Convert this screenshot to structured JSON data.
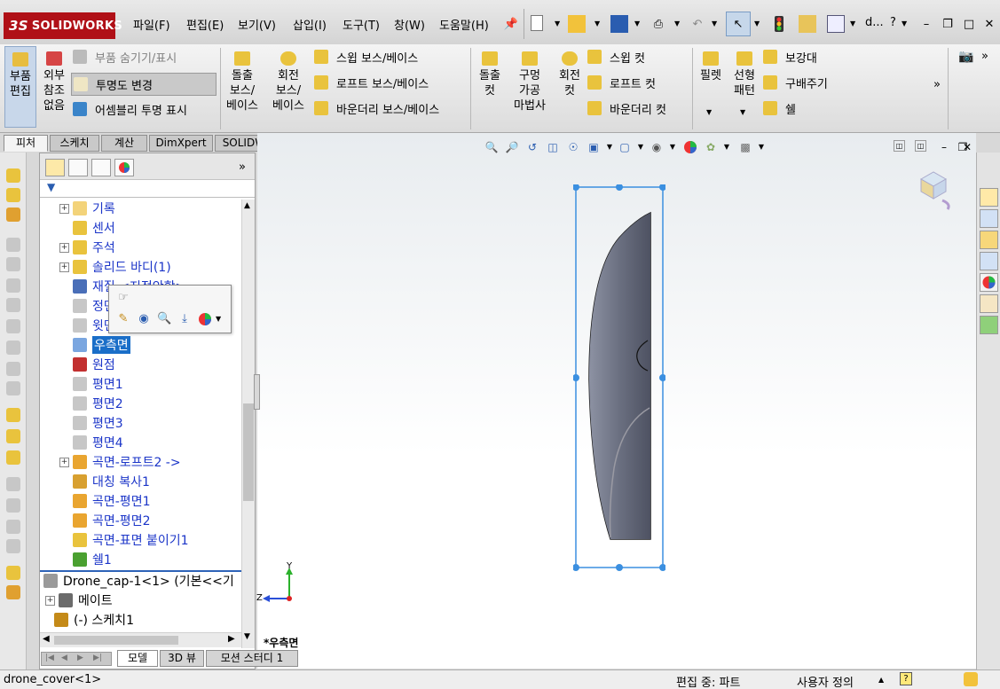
{
  "app": {
    "brand_prefix": "3S",
    "brand": "SOLIDWORKS"
  },
  "menu": [
    "파일(F)",
    "편집(E)",
    "보기(V)",
    "삽입(I)",
    "도구(T)",
    "창(W)",
    "도움말(H)"
  ],
  "titlebar": {
    "doc_short": "d...",
    "help": "?"
  },
  "command_manager": {
    "edit_part": "부품\n편집",
    "external_refs": "외부\n참조\n없음",
    "hide_show": "부품 숨기기/표시",
    "change_transparency": "투명도 변경",
    "assembly_transparency": "어셈블리 투명 표시",
    "extruded_boss": "돌출\n보스/\n베이스",
    "revolved_boss": "회전\n보스/\n베이스",
    "swept_boss": "스윕 보스/베이스",
    "lofted_boss": "로프트 보스/베이스",
    "boundary_boss": "바운더리 보스/베이스",
    "extruded_cut": "돌출\n컷",
    "hole_wizard": "구멍\n가공\n마법사",
    "revolved_cut": "회전\n컷",
    "swept_cut": "스윕 컷",
    "lofted_cut": "로프트 컷",
    "boundary_cut": "바운더리 컷",
    "fillet": "필렛",
    "linear_pattern": "선형\n패턴",
    "rib": "보강대",
    "draft": "구배주기",
    "shell": "쉘",
    "more": "»"
  },
  "tabs": [
    "피처",
    "스케치",
    "계산",
    "DimXpert",
    "SOLIDWORKS 애드인"
  ],
  "feature_tree": {
    "expand_arrow": "»",
    "items": [
      {
        "label": "기록",
        "expand": "+"
      },
      {
        "label": "센서"
      },
      {
        "label": "주석",
        "expand": "+"
      },
      {
        "label": "솔리드 바디(1)",
        "expand": "+"
      },
      {
        "label": "재질 <지정안함>"
      },
      {
        "label": "정면"
      },
      {
        "label": "윗면"
      },
      {
        "label": "우측면"
      },
      {
        "label": "원점"
      },
      {
        "label": "평면1"
      },
      {
        "label": "평면2"
      },
      {
        "label": "평면3"
      },
      {
        "label": "평면4"
      },
      {
        "label": "곡면-로프트2 ->",
        "expand": "+"
      },
      {
        "label": "대칭 복사1"
      },
      {
        "label": "곡면-평면1"
      },
      {
        "label": "곡면-평면2"
      },
      {
        "label": "곡면-표면 붙이기1"
      },
      {
        "label": "쉘1"
      }
    ],
    "assembly_items": [
      {
        "label": "Drone_cap-1<1> (기본<<기"
      },
      {
        "label": "메이트",
        "expand": "+"
      },
      {
        "label": "(-) 스케치1"
      }
    ]
  },
  "viewport": {
    "view_label": "*우측면",
    "axis_y": "Y",
    "axis_z": "Z"
  },
  "bottom_tabs": [
    "모델",
    "3D 뷰",
    "모션 스터디 1"
  ],
  "status": {
    "doc": "drone_cover<1>",
    "mode": "편집 중: 파트",
    "units": "사용자 정의",
    "help": "?"
  },
  "colors": {
    "brand": "#b01017",
    "selection": "#1a6ec8",
    "tree_text": "#1b35c8",
    "body": "#6b7080",
    "bbox": "#3b8fe0"
  }
}
